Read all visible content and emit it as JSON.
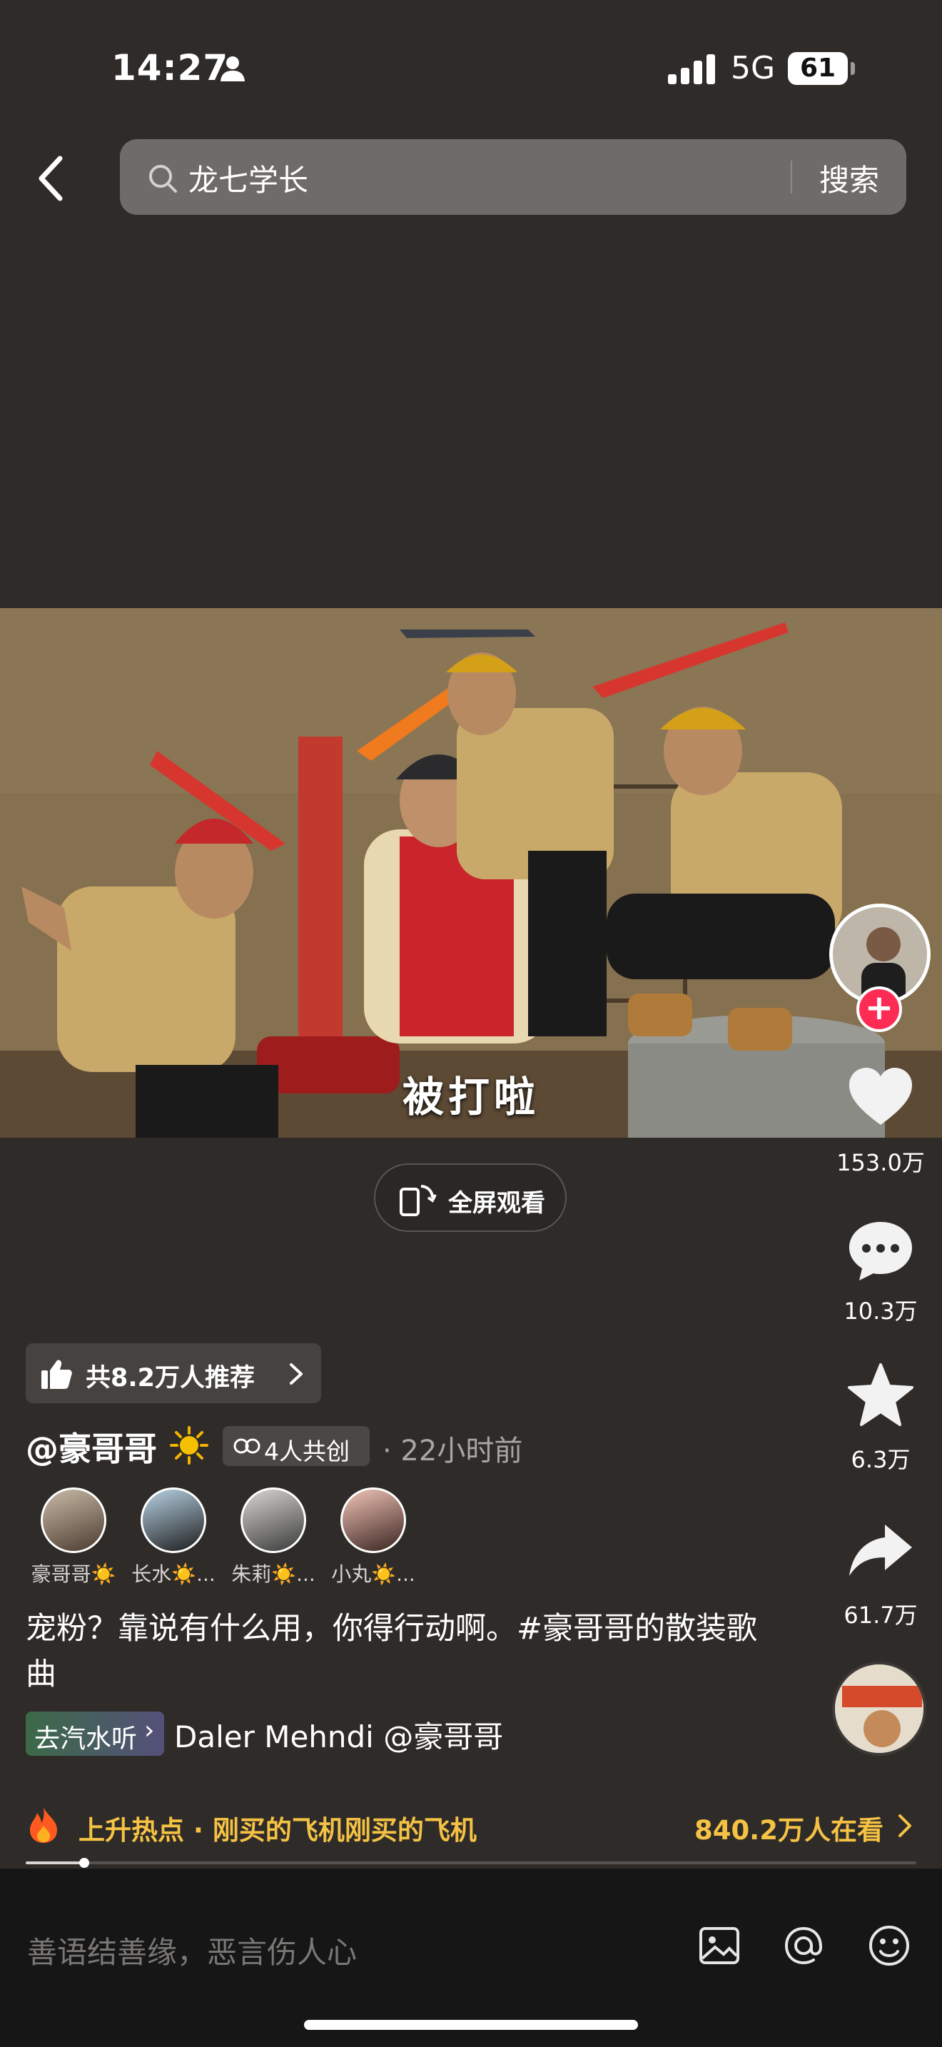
{
  "status_bar": {
    "time": "14:27",
    "network": "5G",
    "battery": "61"
  },
  "search": {
    "query": "龙七学长",
    "button_label": "搜索"
  },
  "video": {
    "caption": "被打啦",
    "fullscreen_label": "全屏观看"
  },
  "actions": {
    "likes": "153.0万",
    "comments": "10.3万",
    "favorites": "6.3万",
    "shares": "61.7万"
  },
  "recommend": {
    "label": "共8.2万人推荐"
  },
  "author": {
    "handle": "@豪哥哥",
    "cocreate_label": "4人共创",
    "time": "· 22小时前"
  },
  "collaborators": [
    {
      "name": "豪哥哥☀️"
    },
    {
      "name": "长水☀️..."
    },
    {
      "name": "朱莉☀️..."
    },
    {
      "name": "小丸☀️..."
    }
  ],
  "description": "宠粉？靠说有什么用，你得行动啊。#豪哥哥的散装歌曲",
  "music": {
    "badge_label": "去汽水听",
    "track": "Daler Mehndi    @豪哥哥"
  },
  "hot": {
    "label": "上升热点 · 刚买的飞机刚买的飞机",
    "viewers": "840.2万人在看"
  },
  "progress": {
    "fraction": 0.066
  },
  "comment": {
    "placeholder": "善语结善缘，恶言伤人心"
  },
  "colors": {
    "background": "#2e2b29",
    "accent_pink": "#fe2c55",
    "hot_yellow": "#f5c244"
  }
}
